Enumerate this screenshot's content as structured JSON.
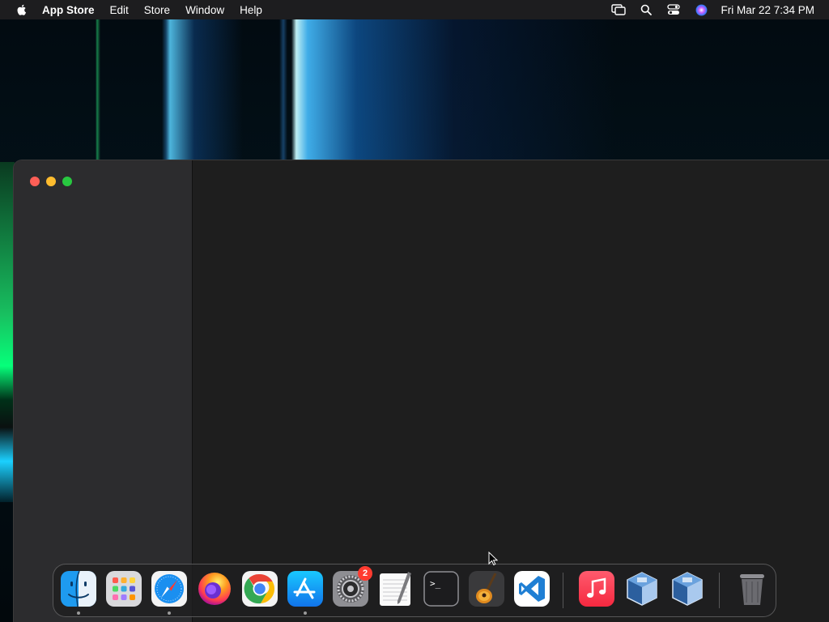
{
  "menubar": {
    "app_name": "App Store",
    "menus": [
      "Edit",
      "Store",
      "Window",
      "Help"
    ],
    "status_icons": [
      "screen-mirroring-icon",
      "search-icon",
      "control-center-icon",
      "siri-icon"
    ],
    "clock": "Fri Mar 22  7:34 PM"
  },
  "window": {
    "traffic_lights": {
      "close": "#fe5f57",
      "minimize": "#febc2e",
      "maximize": "#28c840"
    }
  },
  "dock": {
    "apps": [
      {
        "name": "Finder",
        "icon": "finder-icon",
        "running": true
      },
      {
        "name": "Launchpad",
        "icon": "launchpad-icon",
        "running": false
      },
      {
        "name": "Safari",
        "icon": "safari-icon",
        "running": true
      },
      {
        "name": "Firefox",
        "icon": "firefox-icon",
        "running": false
      },
      {
        "name": "Google Chrome",
        "icon": "chrome-icon",
        "running": false
      },
      {
        "name": "App Store",
        "icon": "app-store-icon",
        "running": true
      },
      {
        "name": "System Settings",
        "icon": "system-settings-icon",
        "running": false,
        "badge": "2"
      },
      {
        "name": "TextEdit",
        "icon": "textedit-icon",
        "running": false
      },
      {
        "name": "Terminal",
        "icon": "terminal-icon",
        "running": false
      },
      {
        "name": "GarageBand",
        "icon": "garageband-icon",
        "running": false
      },
      {
        "name": "Visual Studio Code",
        "icon": "vscode-icon",
        "running": false
      },
      {
        "name": "Music",
        "icon": "music-icon",
        "running": false
      },
      {
        "name": "VirtualBox",
        "icon": "virtualbox-icon",
        "running": false
      },
      {
        "name": "VirtualBox",
        "icon": "virtualbox-icon",
        "running": false
      },
      {
        "name": "Trash",
        "icon": "trash-icon",
        "running": false
      }
    ]
  }
}
